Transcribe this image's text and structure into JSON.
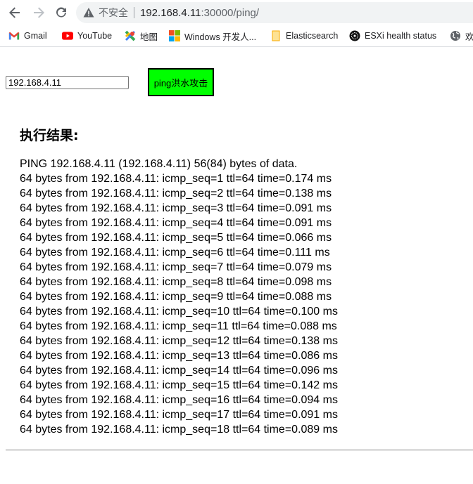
{
  "browser": {
    "security_label": "不安全",
    "url_host": "192.168.4.11",
    "url_rest": ":30000/ping/",
    "bookmarks": [
      {
        "label": "Gmail",
        "icon": "gmail-icon"
      },
      {
        "label": "YouTube",
        "icon": "youtube-icon"
      },
      {
        "label": "地图",
        "icon": "maps-icon"
      },
      {
        "label": "Windows 开发人...",
        "icon": "windows-icon"
      },
      {
        "label": "Elasticsearch",
        "icon": "folder-icon"
      },
      {
        "label": "ESXi health status",
        "icon": "esxi-icon"
      },
      {
        "label": "欢",
        "icon": "globe-icon"
      }
    ]
  },
  "page": {
    "ip_input_value": "192.168.4.11",
    "ping_button_label": "ping洪水攻击",
    "result_title": "执行结果:",
    "output_lines": [
      "PING 192.168.4.11 (192.168.4.11) 56(84) bytes of data.",
      "64 bytes from 192.168.4.11: icmp_seq=1 ttl=64 time=0.174 ms",
      "64 bytes from 192.168.4.11: icmp_seq=2 ttl=64 time=0.138 ms",
      "64 bytes from 192.168.4.11: icmp_seq=3 ttl=64 time=0.091 ms",
      "64 bytes from 192.168.4.11: icmp_seq=4 ttl=64 time=0.091 ms",
      "64 bytes from 192.168.4.11: icmp_seq=5 ttl=64 time=0.066 ms",
      "64 bytes from 192.168.4.11: icmp_seq=6 ttl=64 time=0.111 ms",
      "64 bytes from 192.168.4.11: icmp_seq=7 ttl=64 time=0.079 ms",
      "64 bytes from 192.168.4.11: icmp_seq=8 ttl=64 time=0.098 ms",
      "64 bytes from 192.168.4.11: icmp_seq=9 ttl=64 time=0.088 ms",
      "64 bytes from 192.168.4.11: icmp_seq=10 ttl=64 time=0.100 ms",
      "64 bytes from 192.168.4.11: icmp_seq=11 ttl=64 time=0.088 ms",
      "64 bytes from 192.168.4.11: icmp_seq=12 ttl=64 time=0.138 ms",
      "64 bytes from 192.168.4.11: icmp_seq=13 ttl=64 time=0.086 ms",
      "64 bytes from 192.168.4.11: icmp_seq=14 ttl=64 time=0.096 ms",
      "64 bytes from 192.168.4.11: icmp_seq=15 ttl=64 time=0.142 ms",
      "64 bytes from 192.168.4.11: icmp_seq=16 ttl=64 time=0.094 ms",
      "64 bytes from 192.168.4.11: icmp_seq=17 ttl=64 time=0.091 ms",
      "64 bytes from 192.168.4.11: icmp_seq=18 ttl=64 time=0.089 ms"
    ]
  },
  "colors": {
    "ping_button_bg": "#00ff00",
    "omnibox_bg": "#f1f3f4"
  }
}
